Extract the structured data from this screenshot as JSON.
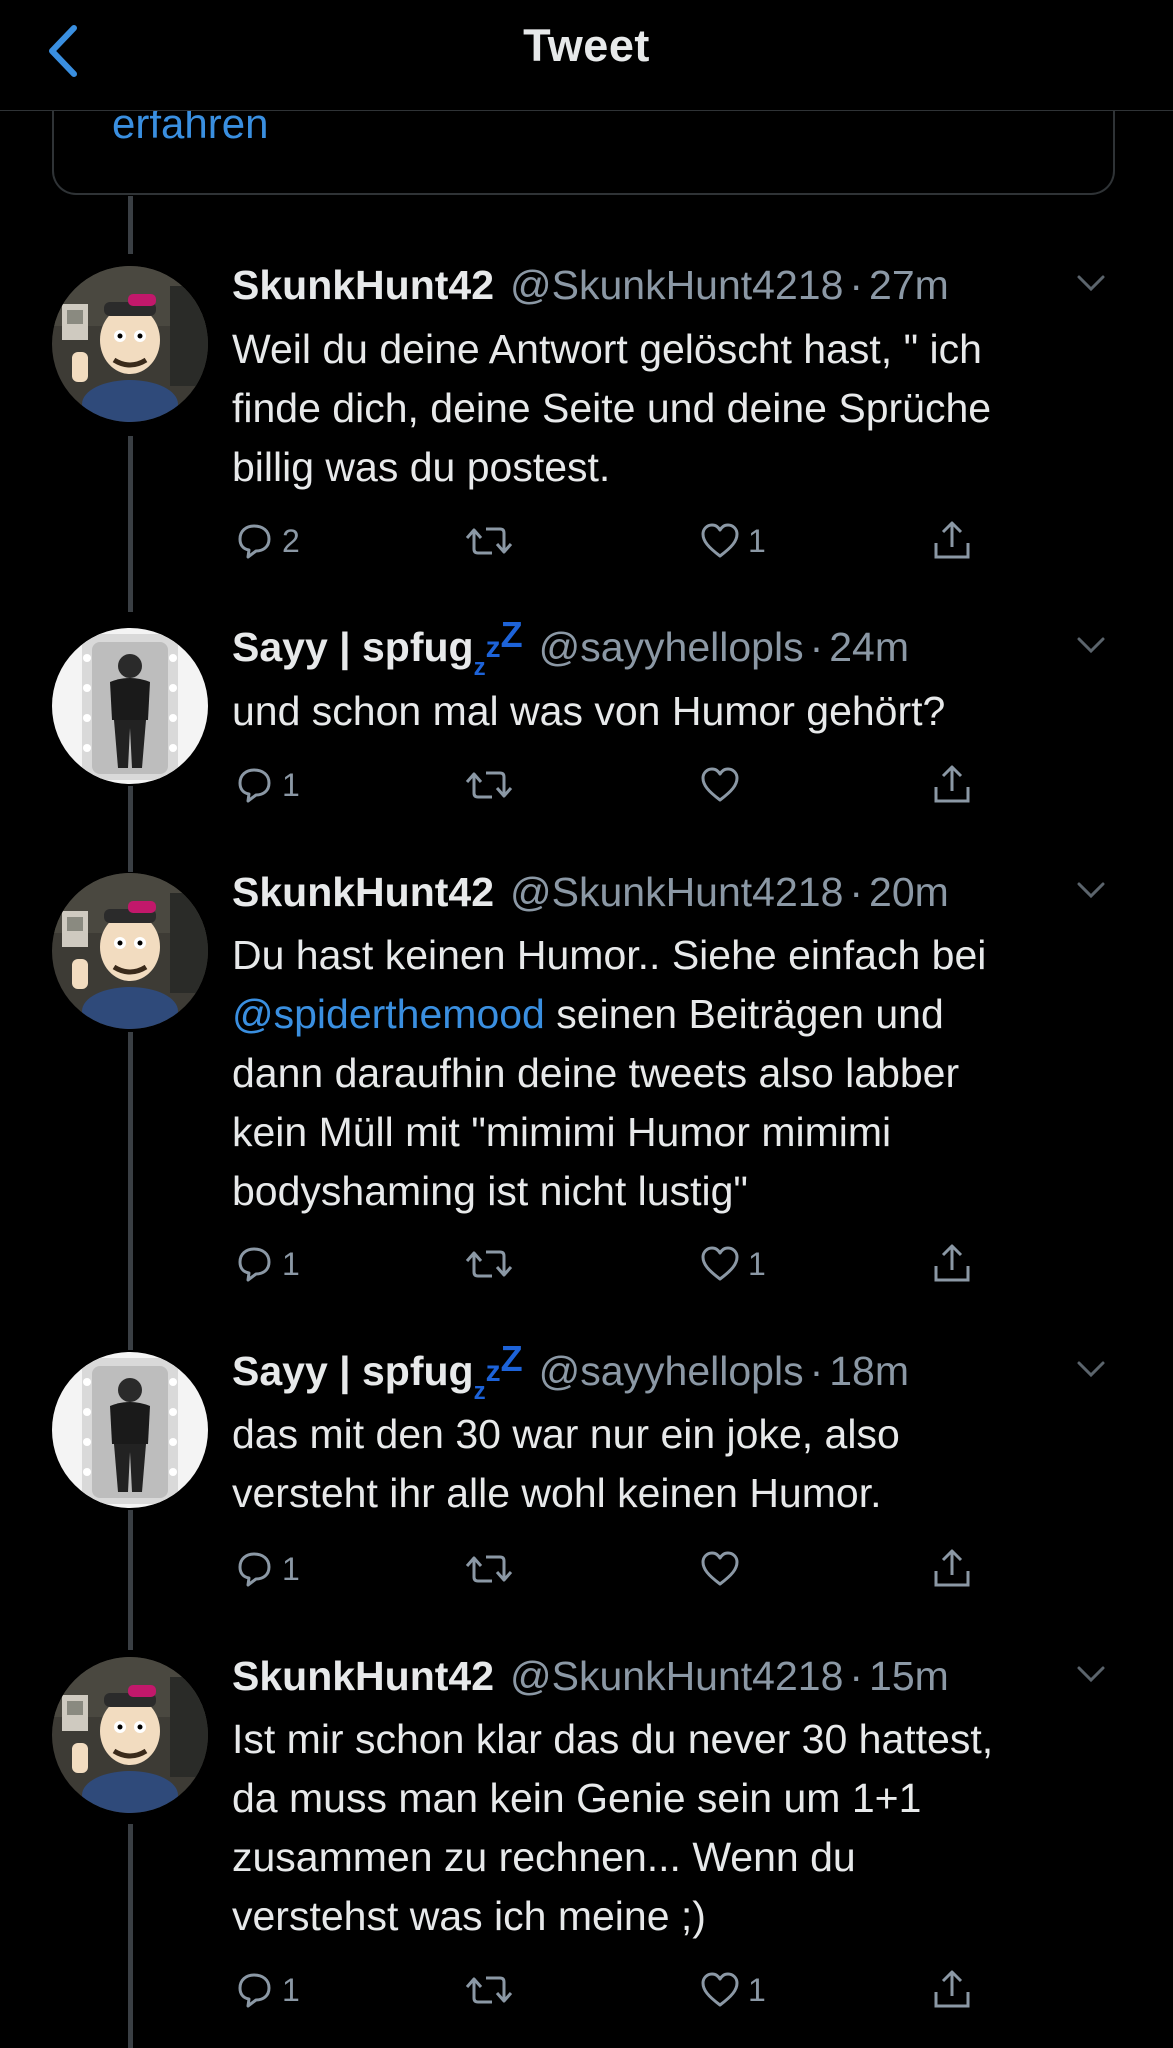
{
  "header": {
    "title": "Tweet"
  },
  "card": {
    "link_text": "erfahren"
  },
  "tweets": [
    {
      "display_name": "SkunkHunt42",
      "handle": "@SkunkHunt4218",
      "time": "27m",
      "lines": [
        "Weil du deine Antwort gelöscht hast, \" ich",
        "finde dich, deine Seite und deine Sprüche",
        "billig was du postest."
      ],
      "reply_count": "2",
      "like_count": "1"
    },
    {
      "display_name": "Sayy | spfug",
      "zz": [
        "z",
        "z",
        "Z"
      ],
      "handle": "@sayyhellopls",
      "time": "24m",
      "lines": [
        "und schon mal was von Humor gehört?"
      ],
      "reply_count": "1",
      "like_count": ""
    },
    {
      "display_name": "SkunkHunt42",
      "handle": "@SkunkHunt4218",
      "time": "20m",
      "line1": "Du hast keinen Humor.. Siehe einfach bei",
      "mention": "@spiderthemood",
      "line2_rest": " seinen Beiträgen und",
      "lines": [
        "dann daraufhin deine tweets also labber",
        "kein Müll mit \"mimimi Humor mimimi",
        "bodyshaming ist nicht lustig\""
      ],
      "reply_count": "1",
      "like_count": "1"
    },
    {
      "display_name": "Sayy | spfug",
      "zz": [
        "z",
        "z",
        "Z"
      ],
      "handle": "@sayyhellopls",
      "time": "18m",
      "lines": [
        "das mit den 30 war nur ein joke, also",
        "versteht ihr alle wohl keinen Humor."
      ],
      "reply_count": "1",
      "like_count": ""
    },
    {
      "display_name": "SkunkHunt42",
      "handle": "@SkunkHunt4218",
      "time": "15m",
      "lines": [
        "Ist mir schon klar das du never 30 hattest,",
        "da muss man kein Genie sein um 1+1",
        "zusammen zu rechnen... Wenn du",
        "verstehst was ich meine ;)"
      ],
      "reply_count": "1",
      "like_count": "1"
    }
  ]
}
